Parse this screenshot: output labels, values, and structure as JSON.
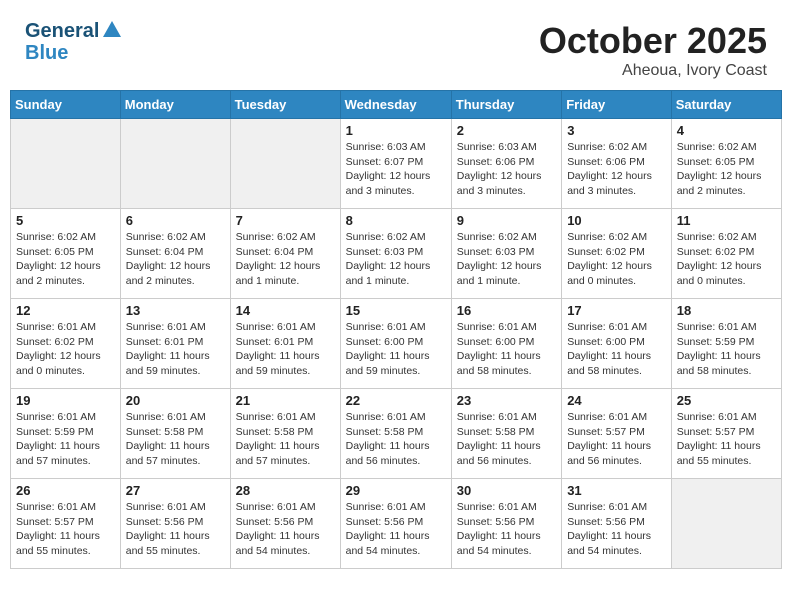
{
  "header": {
    "logo_line1": "General",
    "logo_line2": "Blue",
    "month": "October 2025",
    "location": "Aheoua, Ivory Coast"
  },
  "weekdays": [
    "Sunday",
    "Monday",
    "Tuesday",
    "Wednesday",
    "Thursday",
    "Friday",
    "Saturday"
  ],
  "weeks": [
    [
      {
        "day": "",
        "info": ""
      },
      {
        "day": "",
        "info": ""
      },
      {
        "day": "",
        "info": ""
      },
      {
        "day": "1",
        "info": "Sunrise: 6:03 AM\nSunset: 6:07 PM\nDaylight: 12 hours\nand 3 minutes."
      },
      {
        "day": "2",
        "info": "Sunrise: 6:03 AM\nSunset: 6:06 PM\nDaylight: 12 hours\nand 3 minutes."
      },
      {
        "day": "3",
        "info": "Sunrise: 6:02 AM\nSunset: 6:06 PM\nDaylight: 12 hours\nand 3 minutes."
      },
      {
        "day": "4",
        "info": "Sunrise: 6:02 AM\nSunset: 6:05 PM\nDaylight: 12 hours\nand 2 minutes."
      }
    ],
    [
      {
        "day": "5",
        "info": "Sunrise: 6:02 AM\nSunset: 6:05 PM\nDaylight: 12 hours\nand 2 minutes."
      },
      {
        "day": "6",
        "info": "Sunrise: 6:02 AM\nSunset: 6:04 PM\nDaylight: 12 hours\nand 2 minutes."
      },
      {
        "day": "7",
        "info": "Sunrise: 6:02 AM\nSunset: 6:04 PM\nDaylight: 12 hours\nand 1 minute."
      },
      {
        "day": "8",
        "info": "Sunrise: 6:02 AM\nSunset: 6:03 PM\nDaylight: 12 hours\nand 1 minute."
      },
      {
        "day": "9",
        "info": "Sunrise: 6:02 AM\nSunset: 6:03 PM\nDaylight: 12 hours\nand 1 minute."
      },
      {
        "day": "10",
        "info": "Sunrise: 6:02 AM\nSunset: 6:02 PM\nDaylight: 12 hours\nand 0 minutes."
      },
      {
        "day": "11",
        "info": "Sunrise: 6:02 AM\nSunset: 6:02 PM\nDaylight: 12 hours\nand 0 minutes."
      }
    ],
    [
      {
        "day": "12",
        "info": "Sunrise: 6:01 AM\nSunset: 6:02 PM\nDaylight: 12 hours\nand 0 minutes."
      },
      {
        "day": "13",
        "info": "Sunrise: 6:01 AM\nSunset: 6:01 PM\nDaylight: 11 hours\nand 59 minutes."
      },
      {
        "day": "14",
        "info": "Sunrise: 6:01 AM\nSunset: 6:01 PM\nDaylight: 11 hours\nand 59 minutes."
      },
      {
        "day": "15",
        "info": "Sunrise: 6:01 AM\nSunset: 6:00 PM\nDaylight: 11 hours\nand 59 minutes."
      },
      {
        "day": "16",
        "info": "Sunrise: 6:01 AM\nSunset: 6:00 PM\nDaylight: 11 hours\nand 58 minutes."
      },
      {
        "day": "17",
        "info": "Sunrise: 6:01 AM\nSunset: 6:00 PM\nDaylight: 11 hours\nand 58 minutes."
      },
      {
        "day": "18",
        "info": "Sunrise: 6:01 AM\nSunset: 5:59 PM\nDaylight: 11 hours\nand 58 minutes."
      }
    ],
    [
      {
        "day": "19",
        "info": "Sunrise: 6:01 AM\nSunset: 5:59 PM\nDaylight: 11 hours\nand 57 minutes."
      },
      {
        "day": "20",
        "info": "Sunrise: 6:01 AM\nSunset: 5:58 PM\nDaylight: 11 hours\nand 57 minutes."
      },
      {
        "day": "21",
        "info": "Sunrise: 6:01 AM\nSunset: 5:58 PM\nDaylight: 11 hours\nand 57 minutes."
      },
      {
        "day": "22",
        "info": "Sunrise: 6:01 AM\nSunset: 5:58 PM\nDaylight: 11 hours\nand 56 minutes."
      },
      {
        "day": "23",
        "info": "Sunrise: 6:01 AM\nSunset: 5:58 PM\nDaylight: 11 hours\nand 56 minutes."
      },
      {
        "day": "24",
        "info": "Sunrise: 6:01 AM\nSunset: 5:57 PM\nDaylight: 11 hours\nand 56 minutes."
      },
      {
        "day": "25",
        "info": "Sunrise: 6:01 AM\nSunset: 5:57 PM\nDaylight: 11 hours\nand 55 minutes."
      }
    ],
    [
      {
        "day": "26",
        "info": "Sunrise: 6:01 AM\nSunset: 5:57 PM\nDaylight: 11 hours\nand 55 minutes."
      },
      {
        "day": "27",
        "info": "Sunrise: 6:01 AM\nSunset: 5:56 PM\nDaylight: 11 hours\nand 55 minutes."
      },
      {
        "day": "28",
        "info": "Sunrise: 6:01 AM\nSunset: 5:56 PM\nDaylight: 11 hours\nand 54 minutes."
      },
      {
        "day": "29",
        "info": "Sunrise: 6:01 AM\nSunset: 5:56 PM\nDaylight: 11 hours\nand 54 minutes."
      },
      {
        "day": "30",
        "info": "Sunrise: 6:01 AM\nSunset: 5:56 PM\nDaylight: 11 hours\nand 54 minutes."
      },
      {
        "day": "31",
        "info": "Sunrise: 6:01 AM\nSunset: 5:56 PM\nDaylight: 11 hours\nand 54 minutes."
      },
      {
        "day": "",
        "info": ""
      }
    ]
  ]
}
